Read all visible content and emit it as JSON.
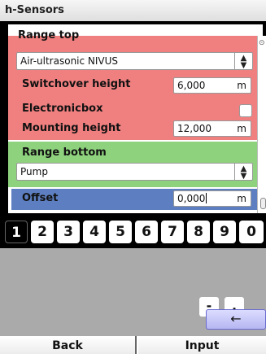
{
  "window": {
    "title": "h-Sensors"
  },
  "range_top": {
    "label": "Range top",
    "sensor_type": "Air-ultrasonic NIVUS",
    "switchover_height": {
      "label": "Switchover height",
      "value": "6,000",
      "unit": "m"
    },
    "electronicbox": {
      "label": "Electronicbox",
      "checked": false
    },
    "mounting_height": {
      "label": "Mounting height",
      "value": "12,000",
      "unit": "m"
    }
  },
  "range_bottom": {
    "label": "Range bottom",
    "sensor_type": "Pump",
    "offset": {
      "label": "Offset",
      "value": "0,000",
      "unit": "m"
    }
  },
  "keyboard": {
    "digits": [
      "1",
      "2",
      "3",
      "4",
      "5",
      "6",
      "7",
      "8",
      "9",
      "0"
    ],
    "selected": "1",
    "minus": "-",
    "comma": ",",
    "backspace": "←"
  },
  "softkeys": {
    "back": "Back",
    "input": "Input"
  },
  "colors": {
    "range_top_bg": "#f08080",
    "range_bottom_bg": "#8ed27e",
    "active_field_bg": "#5d7fc1",
    "backspace_bg": "#b6b6f2"
  }
}
